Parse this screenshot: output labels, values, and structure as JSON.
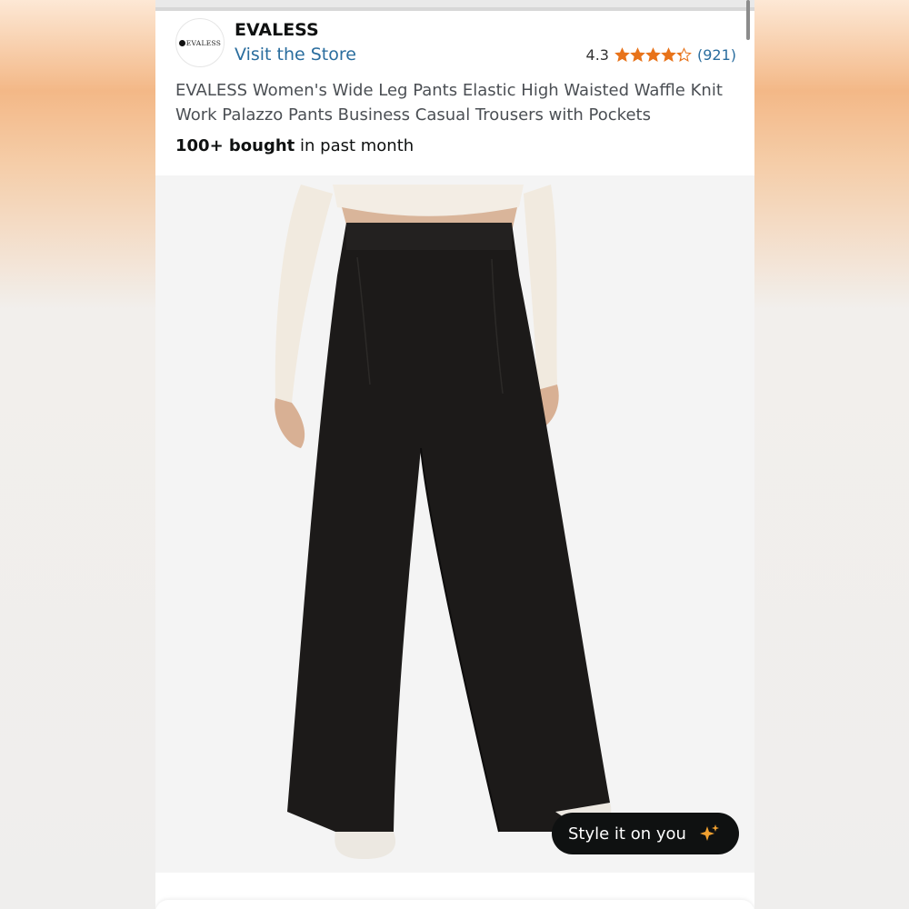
{
  "brand": {
    "logo_text": "EVALESS",
    "name": "EVALESS",
    "visit_store": "Visit the Store"
  },
  "rating": {
    "value": "4.3",
    "stars": 4.3,
    "count": "(921)",
    "star_color": "#e8731a"
  },
  "product": {
    "title_line1": "EVALESS Women's Wide Leg Pants Elastic High Waisted Waffle Knit",
    "title_line2": "Work Palazzo Pants Business Casual Trousers with Pockets",
    "bought_bold": "100+ bought",
    "bought_rest": " in past month"
  },
  "image": {
    "icon": "product-photo-wide-leg-pants",
    "pants_color": "#1c1a19",
    "top_color": "#f1eadf"
  },
  "style_button": {
    "label": "Style it on you",
    "icon": "sparkle-icon",
    "accent": "#f0a030"
  }
}
